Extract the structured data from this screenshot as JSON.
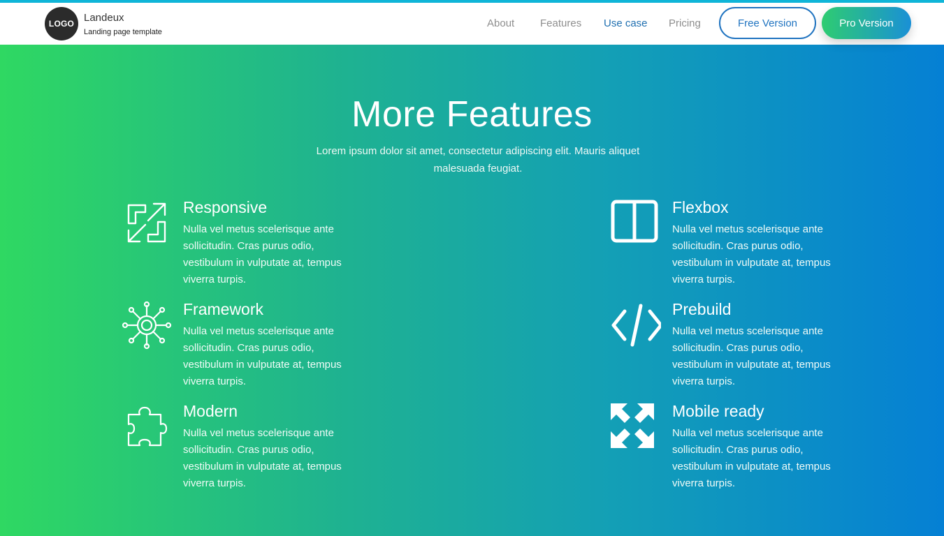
{
  "header": {
    "logo_text": "LOGO",
    "brand_name": "Landeux",
    "brand_tagline": "Landing page template",
    "nav": [
      {
        "label": "About"
      },
      {
        "label": "Features"
      },
      {
        "label": "Use case"
      },
      {
        "label": "Pricing"
      }
    ],
    "free_button": "Free Version",
    "pro_button": "Pro Version"
  },
  "section": {
    "title": "More Features",
    "subtitle": "Lorem ipsum dolor sit amet, consectetur adipiscing elit. Mauris aliquet malesuada feugiat."
  },
  "features": [
    {
      "title": "Responsive",
      "text": "Nulla vel metus scelerisque ante sollicitudin. Cras purus odio, vestibulum in vulputate at, tempus viverra turpis.",
      "icon": "resize-arrows-icon"
    },
    {
      "title": "Framework",
      "text": "Nulla vel metus scelerisque ante sollicitudin. Cras purus odio, vestibulum in vulputate at, tempus viverra turpis.",
      "icon": "virus-gear-icon"
    },
    {
      "title": "Modern",
      "text": "Nulla vel metus scelerisque ante sollicitudin. Cras purus odio, vestibulum in vulputate at, tempus viverra turpis.",
      "icon": "puzzle-piece-icon"
    },
    {
      "title": "Flexbox",
      "text": "Nulla vel metus scelerisque ante sollicitudin. Cras purus odio, vestibulum in vulputate at, tempus viverra turpis.",
      "icon": "columns-icon"
    },
    {
      "title": "Prebuild",
      "text": "Nulla vel metus scelerisque ante sollicitudin. Cras purus odio, vestibulum in vulputate at, tempus viverra turpis.",
      "icon": "code-icon"
    },
    {
      "title": "Mobile ready",
      "text": "Nulla vel metus scelerisque ante sollicitudin. Cras purus odio, vestibulum in vulputate at, tempus viverra turpis.",
      "icon": "expand-arrows-icon"
    }
  ],
  "colors": {
    "accent_blue": "#1f73c0",
    "gradient_start": "#2fd862",
    "gradient_end": "#0580d4",
    "logo_bg": "#2b2b2b"
  }
}
